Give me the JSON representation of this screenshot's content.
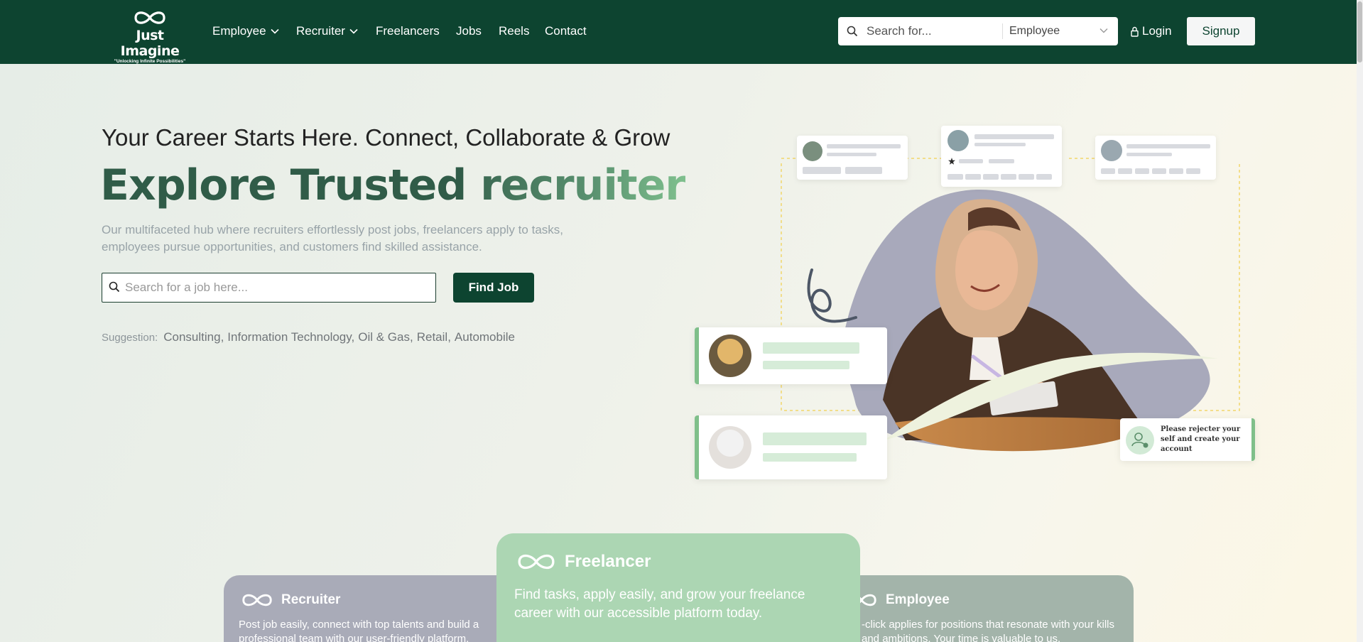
{
  "brand": {
    "name": "Just Imagine",
    "tagline": "\"Unlocking Infinite Possibilities\"",
    "logo_icon": "infinity-icon",
    "colors": {
      "primary": "#0d4430",
      "accent_green": "#7fc08e",
      "white": "#ffffff"
    }
  },
  "nav": {
    "items": [
      {
        "label": "Employee",
        "has_dropdown": true
      },
      {
        "label": "Recruiter",
        "has_dropdown": true
      },
      {
        "label": "Freelancers",
        "has_dropdown": false
      },
      {
        "label": "Jobs",
        "has_dropdown": false
      },
      {
        "label": "Reels",
        "has_dropdown": false
      },
      {
        "label": "Contact",
        "has_dropdown": false
      }
    ],
    "search": {
      "placeholder": "Search for...",
      "category_selected": "Employee"
    },
    "login_label": "Login",
    "signup_label": "Signup"
  },
  "hero": {
    "subheading": "Your Career Starts Here. Connect, Collaborate & Grow",
    "headline_part1": "Explore Trusted",
    "headline_part2": "recruiter",
    "description": "Our multifaceted hub where recruiters effortlessly post jobs, freelancers apply to tasks, employees pursue opportunities, and customers find skilled assistance.",
    "job_search_placeholder": "Search for a job here...",
    "find_job_label": "Find Job",
    "suggestion_label": "Suggestion:",
    "suggestions": [
      "Consulting",
      "Information Technology",
      "Oil & Gas",
      "Retail",
      "Automobile"
    ]
  },
  "illustration": {
    "register_note": "Please rejecter your self and create your account"
  },
  "roles": {
    "recruiter": {
      "title": "Recruiter",
      "text": "Post job easily, connect with top talents and build a professional team with our user-friendly platform."
    },
    "freelancer": {
      "title": "Freelancer",
      "text": "Find tasks, apply easily, and grow your freelance career with our accessible platform today."
    },
    "employee": {
      "title": "Employee",
      "text": "-click applies for positions that resonate with your kills and ambitions. Your time is valuable to us."
    }
  }
}
